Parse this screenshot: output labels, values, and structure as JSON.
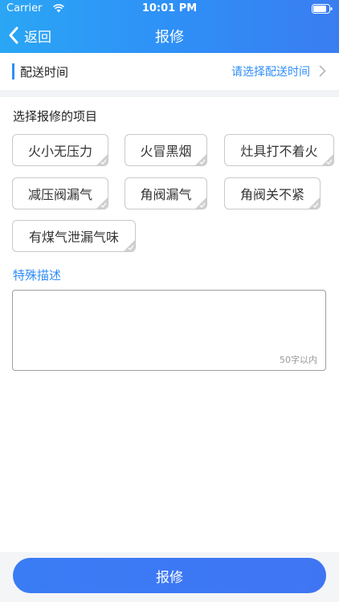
{
  "status_bar": {
    "carrier": "Carrier",
    "time": "10:01 PM"
  },
  "nav": {
    "back_label": "返回",
    "title": "报修"
  },
  "delivery": {
    "label": "配送时间",
    "value": "请选择配送时间"
  },
  "items_section": {
    "title": "选择报修的项目",
    "items": [
      "火小无压力",
      "火冒黑烟",
      "灶具打不着火",
      "减压阀漏气",
      "角阀漏气",
      "角阀关不紧",
      "有煤气泄漏气味"
    ]
  },
  "description": {
    "title": "特殊描述",
    "limit": "50字以内"
  },
  "submit_label": "报修",
  "colors": {
    "accent": "#2f8ef6",
    "header_start": "#2aa6f5",
    "button": "#3a7cf4"
  }
}
